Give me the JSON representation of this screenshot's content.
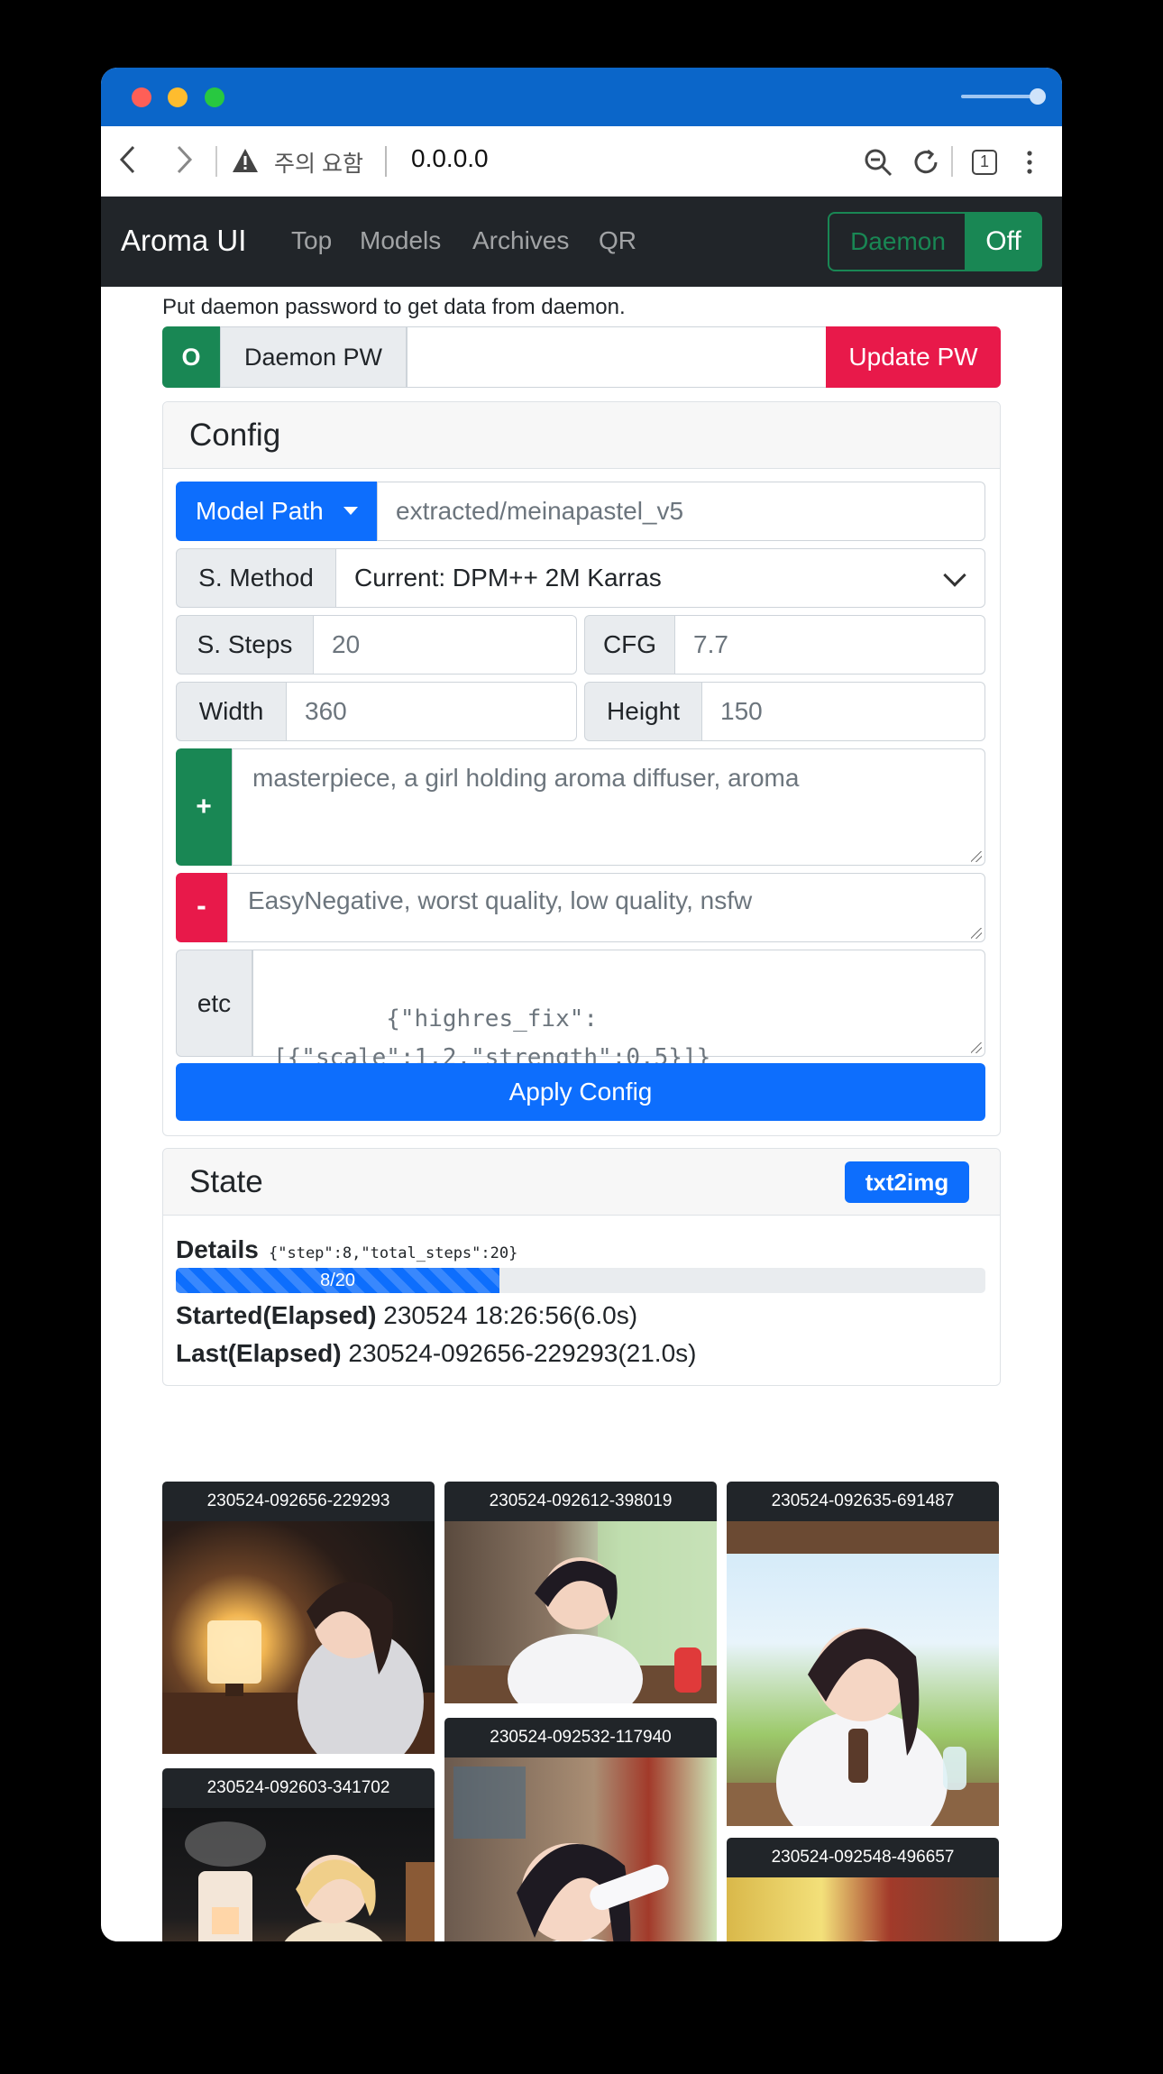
{
  "browser": {
    "warning_text": "주의 요함",
    "host": "0.0.0.0",
    "tab_count": "1"
  },
  "navbar": {
    "brand": "Aroma UI",
    "links": [
      "Top",
      "Models",
      "Archives",
      "QR"
    ],
    "daemon_label": "Daemon",
    "daemon_status": "Off"
  },
  "password": {
    "hint": "Put daemon password to get data from daemon.",
    "status": "O",
    "label": "Daemon PW",
    "value": "",
    "update_label": "Update PW"
  },
  "config": {
    "title": "Config",
    "model_path_label": "Model Path",
    "model_path_value": "extracted/meinapastel_v5",
    "method_label": "S. Method",
    "method_value": "Current: DPM++ 2M Karras",
    "steps_label": "S. Steps",
    "steps_value": "20",
    "cfg_label": "CFG",
    "cfg_value": "7.7",
    "width_label": "Width",
    "width_value": "360",
    "height_label": "Height",
    "height_value": "150",
    "positive_label": "+",
    "positive_prompt": "masterpiece, a girl holding aroma diffuser, aroma",
    "negative_label": "-",
    "negative_prompt": "EasyNegative, worst quality, low quality, nsfw",
    "etc_label": "etc",
    "etc_value": "{\"highres_fix\":\n[{\"scale\":1.2,\"strength\":0.5}]}",
    "apply_label": "Apply Config"
  },
  "state": {
    "title": "State",
    "badge": "txt2img",
    "details_label": "Details",
    "details_json": "{\"step\":8,\"total_steps\":20}",
    "progress_text": "8/20",
    "progress_fraction": 0.4,
    "started_label": "Started(Elapsed)",
    "started_value": "230524 18:26:56(6.0s)",
    "last_label": "Last(Elapsed)",
    "last_value": "230524-092656-229293(21.0s)"
  },
  "gallery": [
    {
      "caption": "230524-092656-229293",
      "scene": "girl by glowing lamp, dark room"
    },
    {
      "caption": "230524-092612-398019",
      "scene": "girl at window with red bottle"
    },
    {
      "caption": "230524-092635-691487",
      "scene": "girl holding bottle outdoors"
    },
    {
      "caption": "230524-092603-341702",
      "scene": "blonde girl with steaming diffuser"
    },
    {
      "caption": "230524-092532-117940",
      "scene": "girl drinking from white bottle"
    },
    {
      "caption": "230524-092548-496657",
      "scene": "girl by sunny window"
    }
  ],
  "colors": {
    "accent": "#0d6efd",
    "success": "#198754",
    "danger": "#e8194a",
    "titlebar": "#0b66c9",
    "navbar": "#212529"
  }
}
